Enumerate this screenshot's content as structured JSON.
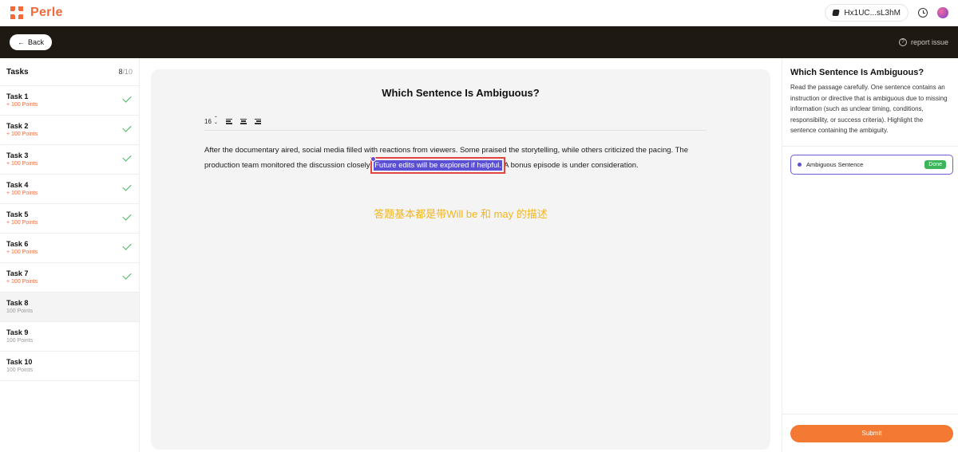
{
  "brand": {
    "name": "Perle"
  },
  "header": {
    "wallet": "Hx1UC...sL3hM"
  },
  "subheader": {
    "back_label": "Back",
    "report_label": "report issue"
  },
  "sidebar": {
    "title": "Tasks",
    "count_done": "8",
    "count_total": "/10",
    "tasks": [
      {
        "name": "Task 1",
        "points": "+ 100 Points",
        "done": true
      },
      {
        "name": "Task 2",
        "points": "+ 100 Points",
        "done": true
      },
      {
        "name": "Task 3",
        "points": "+ 100 Points",
        "done": true
      },
      {
        "name": "Task 4",
        "points": "+ 100 Points",
        "done": true
      },
      {
        "name": "Task 5",
        "points": "+ 100 Points",
        "done": true
      },
      {
        "name": "Task 6",
        "points": "+ 100 Points",
        "done": true
      },
      {
        "name": "Task 7",
        "points": "+ 100 Points",
        "done": true
      },
      {
        "name": "Task 8",
        "points": "100 Points",
        "done": false
      },
      {
        "name": "Task 9",
        "points": "100 Points",
        "done": false
      },
      {
        "name": "Task 10",
        "points": "100 Points",
        "done": false
      }
    ]
  },
  "main": {
    "title": "Which Sentence Is Ambiguous?",
    "font_size": "16",
    "passage_before": "After the documentary aired, social media filled with reactions from viewers. Some praised the storytelling, while others criticized the pacing. The production team monitored the discussion closely. ",
    "passage_highlight": "Future edits will be explored if helpful.",
    "passage_after": " A bonus episode is under consideration.",
    "note": "答题基本都是带Will be 和 may 的描述"
  },
  "panel": {
    "title": "Which Sentence Is Ambiguous?",
    "description": "Read the passage carefully. One sentence contains an instruction or directive that is ambiguous due to missing information (such as unclear timing, conditions, responsibility, or success criteria). Highlight the sentence containing the ambiguity.",
    "label": "Ambiguous Sentence",
    "label_status": "Done",
    "submit_label": "Submit"
  },
  "colors": {
    "accent": "#f26a3b",
    "highlight": "#5b4fd6",
    "done": "#3cb55a",
    "note": "#f2b51b"
  }
}
